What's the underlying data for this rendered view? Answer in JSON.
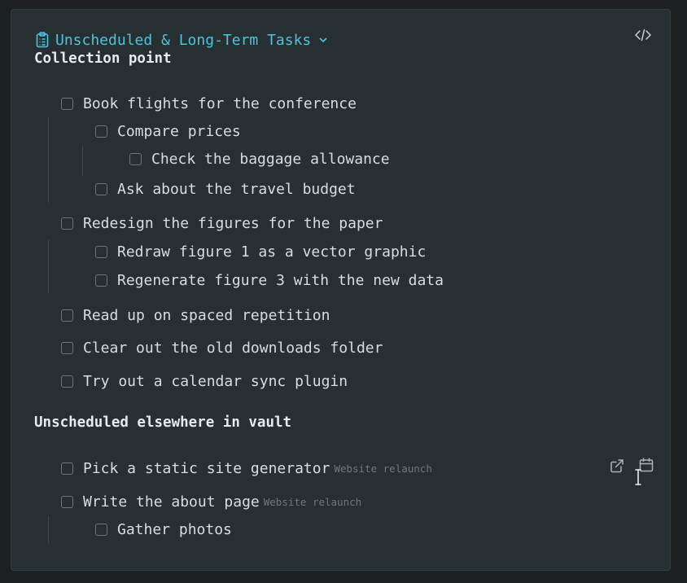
{
  "header": {
    "title": "Unscheduled & Long-Term Tasks",
    "icon": "clipboard-list-icon",
    "chevron_icon": "chevron-down-icon",
    "source_icon": "code-icon",
    "accent_color": "#4fc3dd"
  },
  "sections": [
    {
      "title": "Collection point",
      "tasks": [
        {
          "label": "Book flights for the conference",
          "checked": false
        },
        {
          "label": "Compare prices",
          "checked": false
        },
        {
          "label": "Check the baggage allowance",
          "checked": false
        },
        {
          "label": "Ask about the travel budget",
          "checked": false
        },
        {
          "label": "Redesign the figures for the paper",
          "checked": false
        },
        {
          "label": "Redraw figure 1 as a vector graphic",
          "checked": false
        },
        {
          "label": "Regenerate figure 3 with the new data",
          "checked": false
        },
        {
          "label": "Read up on spaced repetition",
          "checked": false
        },
        {
          "label": "Clear out the old downloads folder",
          "checked": false
        },
        {
          "label": "Try out a calendar sync plugin",
          "checked": false
        }
      ]
    },
    {
      "title": "Unscheduled elsewhere in vault",
      "tasks": [
        {
          "label": "Pick a static site generator",
          "tag": "Website relaunch",
          "checked": false
        },
        {
          "label": "Write the about page",
          "tag": "Website relaunch",
          "checked": false
        },
        {
          "label": "Gather photos",
          "checked": false
        }
      ]
    }
  ],
  "row_actions": {
    "open_icon": "external-link-icon",
    "schedule_icon": "calendar-icon"
  }
}
